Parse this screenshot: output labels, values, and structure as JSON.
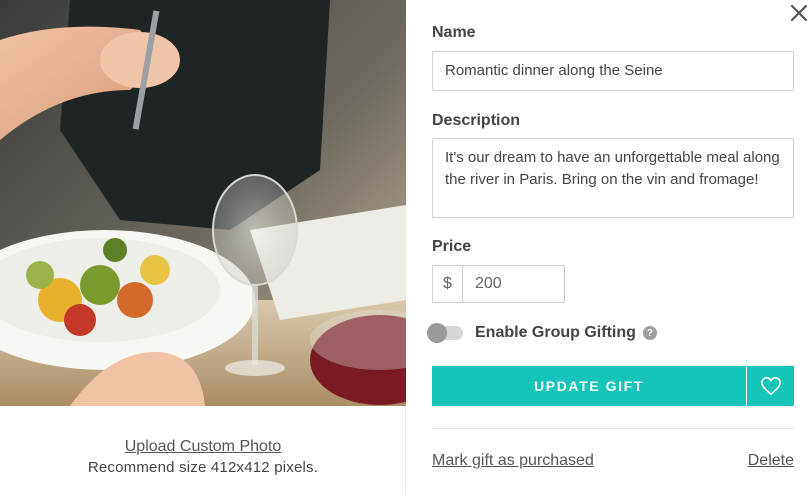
{
  "photo": {
    "upload_label": "Upload Custom Photo",
    "hint": "Recommend size 412x412 pixels."
  },
  "form": {
    "name_label": "Name",
    "name_value": "Romantic dinner along the Seine",
    "description_label": "Description",
    "description_value": "It's our dream to have an unforgettable meal along the river in Paris. Bring on the vin and fromage!",
    "price_label": "Price",
    "currency_symbol": "$",
    "price_value": "200",
    "group_gifting_label": "Enable Group Gifting",
    "help_glyph": "?",
    "update_button": "UPDATE GIFT",
    "mark_purchased": "Mark gift as purchased",
    "delete": "Delete"
  },
  "colors": {
    "accent": "#14c4b8"
  },
  "icons": {
    "close": "close-icon",
    "heart": "heart-icon",
    "help": "help-icon"
  }
}
